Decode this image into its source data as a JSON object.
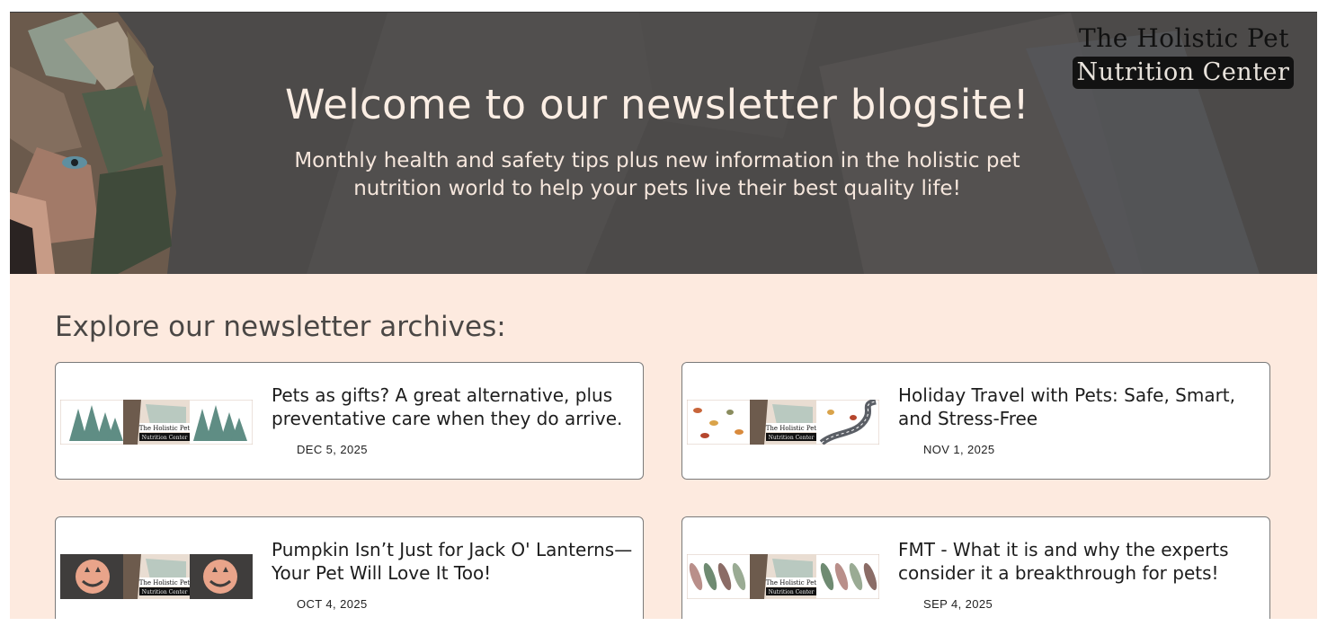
{
  "brand": {
    "line1": "The Holistic Pet",
    "line2": "Nutrition Center"
  },
  "hero": {
    "title": "Welcome to our newsletter blogsite!",
    "subtitle": "Monthly health and safety tips plus new information in the holistic pet nutrition world to help your pets live their best quality life!"
  },
  "archive": {
    "heading": "Explore our newsletter archives:",
    "posts": [
      {
        "title": "Pets as gifts? A great alternative, plus preventative care when they do arrive.",
        "date": "DEC 5, 2025",
        "theme": "pine-trees"
      },
      {
        "title": "Holiday Travel with Pets: Safe, Smart, and Stress-Free",
        "date": "NOV 1, 2025",
        "theme": "autumn-leaves-road"
      },
      {
        "title": "Pumpkin Isn’t Just for Jack O' Lanterns—Your Pet Will Love It Too!",
        "date": "OCT 4, 2025",
        "theme": "jack-o-lanterns"
      },
      {
        "title": "FMT - What it is and why the experts consider it a breakthrough for pets!",
        "date": "SEP 4, 2025",
        "theme": "leaf-pattern"
      }
    ]
  },
  "colors": {
    "hero_bg": "#4c4a49",
    "page_bg": "#fdeadf",
    "hero_text": "#fbeee4",
    "heading_text": "#4a4745"
  }
}
